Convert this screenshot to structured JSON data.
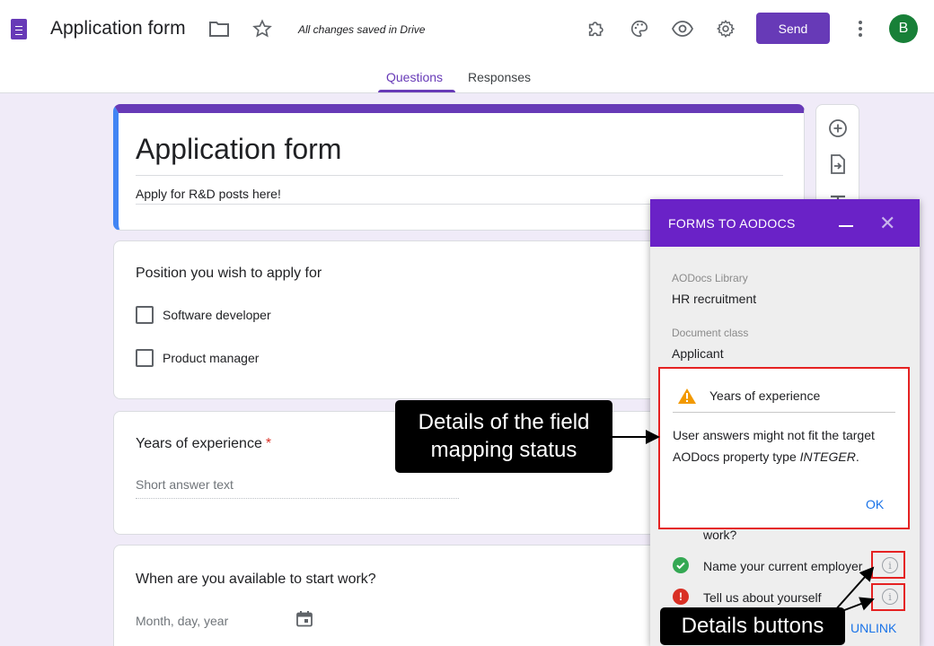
{
  "header": {
    "app_title": "Application form",
    "saved_status": "All changes saved in Drive",
    "send_label": "Send",
    "avatar_initial": "B",
    "tabs": [
      {
        "label": "Questions",
        "active": true
      },
      {
        "label": "Responses",
        "active": false
      }
    ]
  },
  "form": {
    "title": "Application form",
    "description": "Apply for R&D posts here!",
    "questions": [
      {
        "title": "Position you wish to apply for",
        "type": "checkbox",
        "options": [
          "Software developer",
          "Product manager"
        ]
      },
      {
        "title": "Years of experience",
        "required_mark": "*",
        "type": "short-answer",
        "placeholder": "Short answer text"
      },
      {
        "title": "When are you available to start work?",
        "type": "date",
        "placeholder": "Month, day, year"
      }
    ]
  },
  "panel": {
    "title": "FORMS TO AODOCS",
    "library_label": "AODocs Library",
    "library_value": "HR recruitment",
    "class_label": "Document class",
    "class_value": "Applicant",
    "partial_row_text": "work?",
    "rows": [
      {
        "label": "Name your current employer",
        "status": "ok"
      },
      {
        "label": "Tell us about yourself",
        "status": "error"
      }
    ],
    "unlink_label": "UNLINK"
  },
  "popup": {
    "title": "Years of experience",
    "body_prefix": "User answers might not fit the target AODocs property type ",
    "body_type": "INTEGER",
    "body_suffix": ".",
    "ok_label": "OK"
  },
  "annotations": {
    "details_status": "Details of the field mapping status",
    "details_buttons": "Details buttons"
  },
  "colors": {
    "brand": "#673ab7",
    "panel_header": "#6a22c7",
    "background": "#f0ebf8",
    "highlight": "#e52222",
    "link": "#1a73e8"
  }
}
